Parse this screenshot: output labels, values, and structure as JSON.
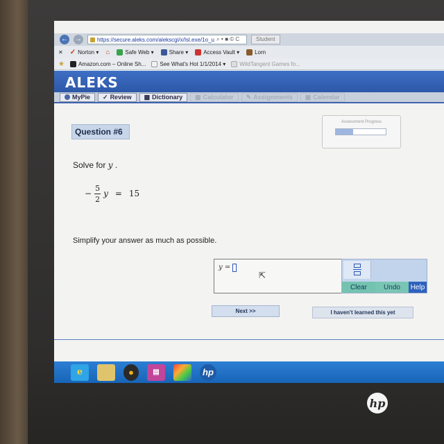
{
  "browser": {
    "url": "https://secure.aleks.com/alekscgi/x/Isl.exe/1o_u",
    "tab_label": "Student",
    "address_icons": "⌕ ▾ ■ © C"
  },
  "toolbar": {
    "items": [
      {
        "label": "Norton ▾"
      },
      {
        "label": "Safe Web ▾"
      },
      {
        "label": "Share ▾"
      },
      {
        "label": "Access Vault ▾"
      },
      {
        "label": "Lorn"
      }
    ]
  },
  "favorites": {
    "items": [
      {
        "label": "Amazon.com – Online Sh..."
      },
      {
        "label": "See What's Hot 1/1/2014 ▾"
      },
      {
        "label": "WildTangent Games fo..."
      }
    ]
  },
  "app": {
    "logo": "ALEKS"
  },
  "nav": {
    "tabs": [
      {
        "label": "MyPie"
      },
      {
        "label": "Review"
      },
      {
        "label": "Dictionary"
      },
      {
        "label": "Calculator"
      },
      {
        "label": "Assignments"
      },
      {
        "label": "Calendar"
      }
    ]
  },
  "question": {
    "title": "Question #6",
    "prompt_prefix": "Solve for",
    "variable": "y",
    "prompt_suffix": ".",
    "equation": {
      "sign": "−",
      "numerator": "5",
      "denominator": "2",
      "variable": "y",
      "equals": "=",
      "rhs": "15"
    },
    "instruction": "Simplify your answer as much as possible."
  },
  "progress": {
    "label": "Assessment Progress",
    "fraction": 0.35
  },
  "answer": {
    "label": "y =",
    "value": ""
  },
  "tools": {
    "clear_label": "Clear",
    "undo_label": "Undo",
    "help_label": "Help"
  },
  "actions": {
    "next_label": "Next >>",
    "not_learned_label": "I haven't learned this yet"
  },
  "taskbar": {
    "icons": [
      "internet-explorer-icon",
      "file-explorer-icon",
      "media-player-icon",
      "app-icon",
      "color-app-icon",
      "hp-icon"
    ],
    "hp_label": "hp"
  },
  "hardware": {
    "logo": "hp"
  },
  "colors": {
    "aleks_blue": "#2d58a8",
    "taskbar_blue": "#1f70c4",
    "clear_green": "#74c2b0",
    "help_blue": "#2e62bd"
  }
}
